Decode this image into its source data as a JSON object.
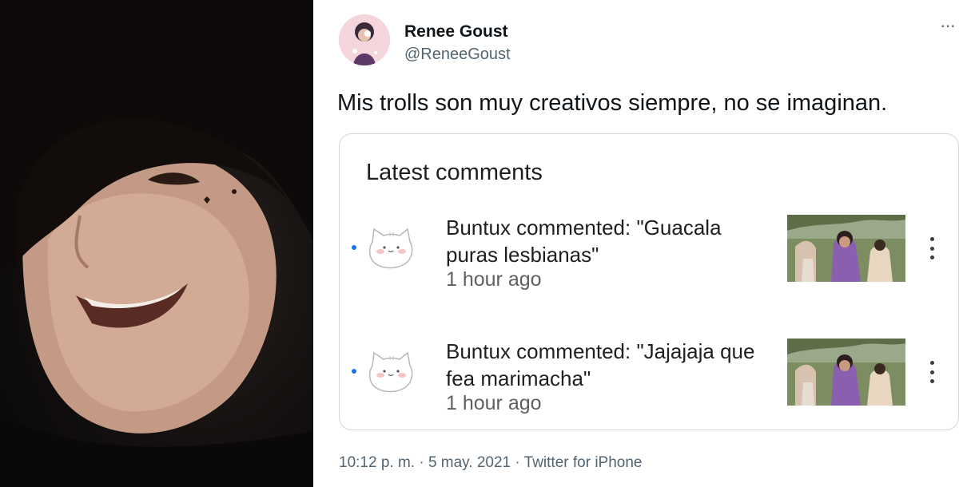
{
  "author": {
    "name": "Renee Goust",
    "handle": "@ReneeGoust"
  },
  "tweet": {
    "text": "Mis trolls son muy creativos siempre, no se imaginan.",
    "more_icon": "more-horizontal-icon",
    "meta": "10:12 p. m. · 5 may. 2021 · Twitter for iPhone"
  },
  "card": {
    "title": "Latest comments",
    "comments": [
      {
        "text": "Buntux commented: \"Guacala puras lesbianas\"",
        "time": "1 hour ago",
        "unread": true
      },
      {
        "text": "Buntux commented: \"Jajajaja que fea marimacha\"",
        "time": "1 hour ago",
        "unread": true
      }
    ]
  },
  "colors": {
    "text_primary": "#0f1419",
    "text_secondary": "#536471",
    "card_border": "#cfd9de",
    "unread_dot": "#1a73e8"
  }
}
